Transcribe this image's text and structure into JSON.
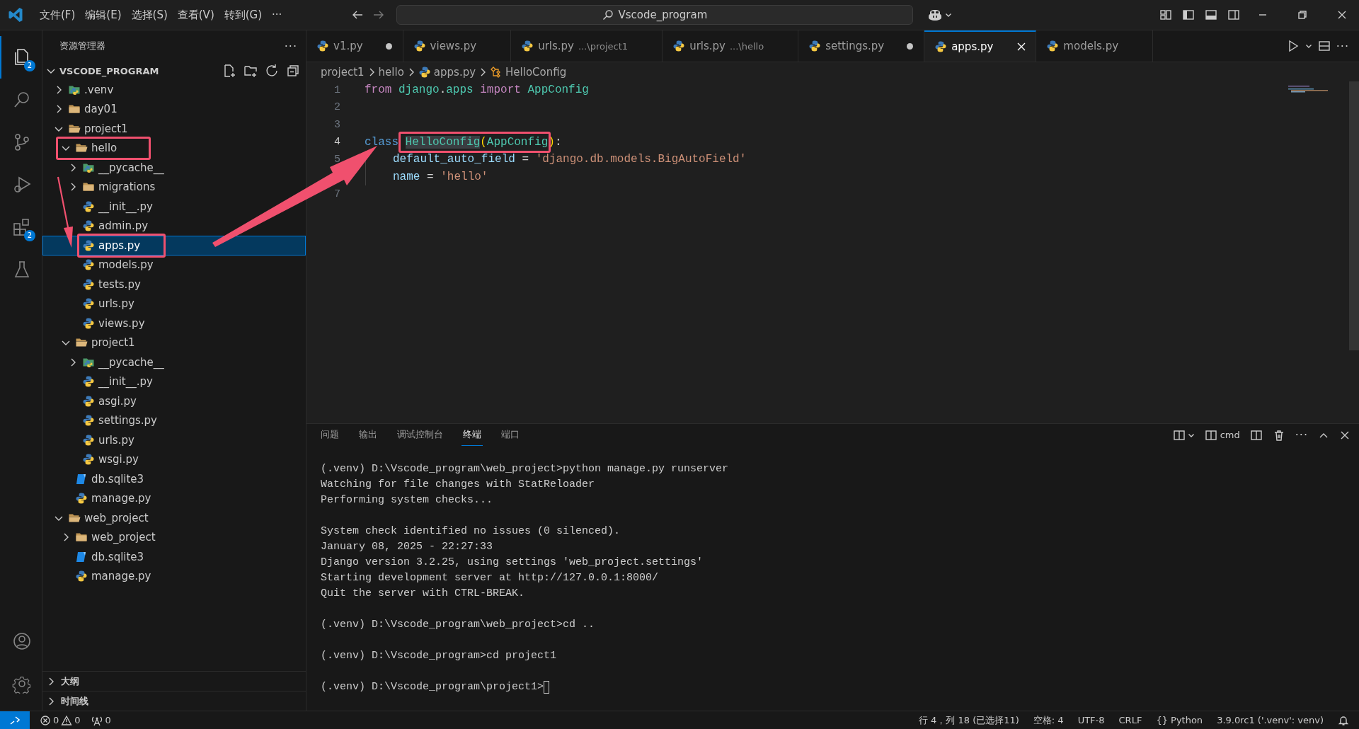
{
  "title_bar": {
    "menu": [
      "文件(F)",
      "编辑(E)",
      "选择(S)",
      "查看(V)",
      "转到(G)",
      "···"
    ],
    "search": {
      "value": "Vscode_program"
    }
  },
  "activity_bar": {
    "items": [
      {
        "kind": "explorer",
        "selected": true,
        "badge": "2"
      },
      {
        "kind": "search",
        "selected": false
      },
      {
        "kind": "source-control",
        "selected": false
      },
      {
        "kind": "run-debug",
        "selected": false
      },
      {
        "kind": "extensions",
        "selected": false,
        "badge": "2"
      },
      {
        "kind": "testing",
        "selected": false
      }
    ],
    "bottom": [
      {
        "kind": "account"
      },
      {
        "kind": "settings"
      }
    ]
  },
  "sidebar": {
    "title": "资源管理器",
    "more": "···",
    "root": "VSCODE_PROGRAM",
    "tree": [
      {
        "label": ".venv",
        "kind": "venv",
        "expanded": false
      },
      {
        "label": "day01",
        "kind": "folder",
        "expanded": false
      },
      {
        "label": "project1",
        "kind": "folder",
        "expanded": true,
        "children": [
          {
            "label": "hello",
            "kind": "folder",
            "expanded": true,
            "annotated": true,
            "children": [
              {
                "label": "__pycache__",
                "kind": "pycache",
                "expanded": false
              },
              {
                "label": "migrations",
                "kind": "folder",
                "expanded": false
              },
              {
                "label": "__init__.py",
                "kind": "python"
              },
              {
                "label": "admin.py",
                "kind": "python"
              },
              {
                "label": "apps.py",
                "kind": "python",
                "selected": true,
                "annotated": true
              },
              {
                "label": "models.py",
                "kind": "python"
              },
              {
                "label": "tests.py",
                "kind": "python"
              },
              {
                "label": "urls.py",
                "kind": "python"
              },
              {
                "label": "views.py",
                "kind": "python"
              }
            ]
          },
          {
            "label": "project1",
            "kind": "folder",
            "expanded": true,
            "children": [
              {
                "label": "__pycache__",
                "kind": "pycache",
                "expanded": false
              },
              {
                "label": "__init__.py",
                "kind": "python"
              },
              {
                "label": "asgi.py",
                "kind": "python"
              },
              {
                "label": "settings.py",
                "kind": "python"
              },
              {
                "label": "urls.py",
                "kind": "python"
              },
              {
                "label": "wsgi.py",
                "kind": "python"
              }
            ]
          },
          {
            "label": "db.sqlite3",
            "kind": "database"
          },
          {
            "label": "manage.py",
            "kind": "python"
          }
        ]
      },
      {
        "label": "web_project",
        "kind": "folder",
        "expanded": true,
        "children": [
          {
            "label": "web_project",
            "kind": "folder",
            "expanded": false
          },
          {
            "label": "db.sqlite3",
            "kind": "database"
          },
          {
            "label": "manage.py",
            "kind": "python"
          }
        ]
      }
    ],
    "sections": [
      {
        "label": "大纲",
        "expanded": false
      },
      {
        "label": "时间线",
        "expanded": false
      }
    ]
  },
  "tabs": [
    {
      "label": "v1.py",
      "modified": true,
      "selected": false
    },
    {
      "label": "views.py",
      "modified": false,
      "selected": false
    },
    {
      "label": "urls.py",
      "detail": "...\\project1",
      "modified": false,
      "selected": false
    },
    {
      "label": "urls.py",
      "detail": "...\\hello",
      "modified": false,
      "selected": false
    },
    {
      "label": "settings.py",
      "modified": true,
      "selected": false
    },
    {
      "label": "apps.py",
      "modified": false,
      "selected": true
    },
    {
      "label": "models.py",
      "modified": false,
      "selected": false
    }
  ],
  "breadcrumbs": [
    {
      "label": "project1",
      "kind": "folder"
    },
    {
      "label": "hello",
      "kind": "folder"
    },
    {
      "label": "apps.py",
      "kind": "python"
    },
    {
      "label": "HelloConfig",
      "kind": "class"
    }
  ],
  "code": [
    {
      "number": "1",
      "current": false,
      "tokens": [
        {
          "text": "from ",
          "kind": "keyword"
        },
        {
          "text": "django",
          "kind": "module"
        },
        {
          "text": ".",
          "kind": "plain"
        },
        {
          "text": "apps ",
          "kind": "module"
        },
        {
          "text": "import ",
          "kind": "keyword"
        },
        {
          "text": "AppConfig",
          "kind": "class"
        }
      ]
    },
    {
      "number": "2",
      "current": false
    },
    {
      "number": "3",
      "current": false
    },
    {
      "number": "4",
      "current": true,
      "tokens": [
        {
          "text": "class ",
          "kind": "storage"
        },
        {
          "text": "HelloConfig",
          "kind": "class",
          "highlighted": true,
          "boxed": true
        },
        {
          "text": "(",
          "kind": "paren",
          "boxed": true
        },
        {
          "text": "AppConfig",
          "kind": "class",
          "boxed": true
        },
        {
          "text": ")",
          "kind": "paren"
        },
        {
          "text": ":",
          "kind": "plain"
        }
      ]
    },
    {
      "number": "5",
      "current": false,
      "indented": true,
      "tokens": [
        {
          "text": "default_auto_field",
          "kind": "variable"
        },
        {
          "text": " = ",
          "kind": "plain"
        },
        {
          "text": "'django.db.models.BigAutoField'",
          "kind": "string"
        }
      ]
    },
    {
      "indented": true,
      "tokens": [
        {
          "text": "name",
          "kind": "variable"
        },
        {
          "text": " = ",
          "kind": "plain"
        },
        {
          "text": "'hello'",
          "kind": "string"
        }
      ]
    },
    {
      "number": "7",
      "current": false
    }
  ],
  "panel": {
    "tabs": [
      {
        "label": "问题",
        "selected": false
      },
      {
        "label": "输出",
        "selected": false
      },
      {
        "label": "调试控制台",
        "selected": false
      },
      {
        "label": "终端",
        "selected": true
      },
      {
        "label": "端口",
        "selected": false
      }
    ],
    "terminal_name": "cmd",
    "terminal": [
      [
        "(.venv) D:\\Vscode_program\\web_project>python manage.py runserver",
        "Watching for file changes with StatReloader",
        "Performing system checks..."
      ],
      [
        "System check identified no issues (0 silenced).",
        "January 08, 2025 - 22:27:33",
        "Django version 3.2.25, using settings 'web_project.settings'",
        "Starting development server at http://127.0.0.1:8000/",
        "Quit the server with CTRL-BREAK."
      ],
      [
        "(.venv) D:\\Vscode_program\\web_project>cd .."
      ],
      [
        "(.venv) D:\\Vscode_program>cd project1"
      ],
      [
        "(.venv) D:\\Vscode_program\\project1>"
      ]
    ]
  },
  "status_bar": {
    "errors": "0",
    "warnings": "0",
    "ports": "0",
    "right": [
      {
        "text": "行 4，列 18 (已选择11)"
      },
      {
        "text": "空格: 4"
      },
      {
        "text": "UTF-8"
      },
      {
        "text": "CRLF"
      },
      {
        "text": "{} Python"
      },
      {
        "text": "3.9.0rc1 ('.venv': venv)"
      }
    ]
  }
}
